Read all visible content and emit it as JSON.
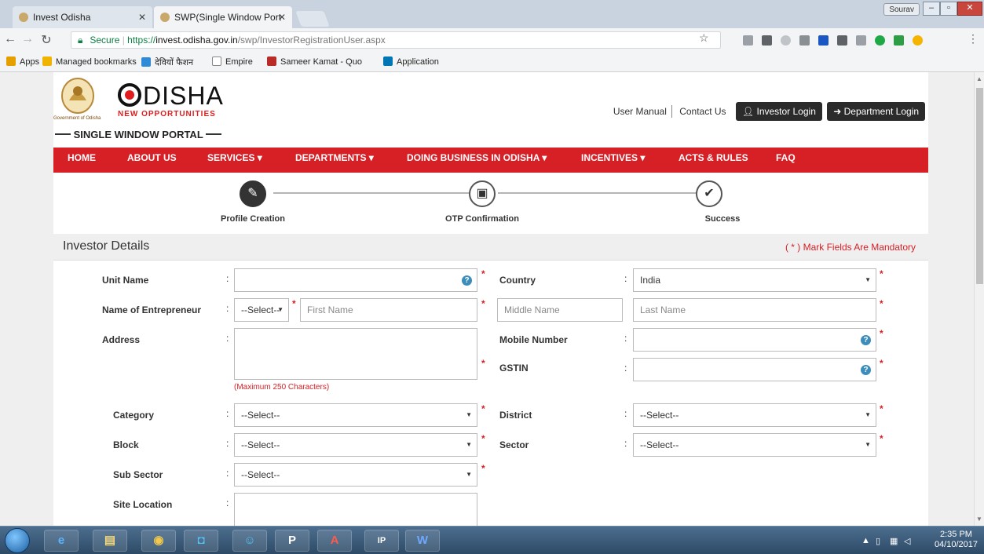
{
  "browser": {
    "tabs": [
      {
        "title": "Invest Odisha",
        "active": false
      },
      {
        "title": "SWP(Single Window Port",
        "active": true
      }
    ],
    "profile": "Sourav",
    "url": {
      "secure_label": "Secure",
      "scheme": "https://",
      "host": "invest.odisha.gov.in",
      "path": "/swp/InvestorRegistrationUser.aspx"
    },
    "bookmarks": [
      {
        "label": "Apps",
        "icon": "apps-grid-icon",
        "color": "#e5a000"
      },
      {
        "label": "Managed bookmarks",
        "icon": "folder-icon",
        "color": "#f0b400"
      },
      {
        "label": "देवियों फैशन",
        "icon": "folder-icon",
        "color": "#2f8ad8"
      },
      {
        "label": "Empire",
        "icon": "page-icon",
        "color": "#888888"
      },
      {
        "label": "Sameer Kamat - Quo",
        "icon": "quora-icon",
        "color": "#b92b27"
      },
      {
        "label": "Application",
        "icon": "linkedin-icon",
        "color": "#0077b5"
      }
    ]
  },
  "site": {
    "emblem_caption": "Government of Odisha",
    "brand": "DISHA",
    "brand_sub": "NEW OPPORTUNITIES",
    "portal": "SINGLE WINDOW PORTAL",
    "top_links": {
      "manual": "User Manual",
      "contact": "Contact Us",
      "investor_login": "Investor Login",
      "department_login": "Department Login"
    },
    "nav": [
      "HOME",
      "ABOUT US",
      "SERVICES ▾",
      "DEPARTMENTS ▾",
      "DOING BUSINESS IN ODISHA ▾",
      "INCENTIVES ▾",
      "ACTS & RULES",
      "FAQ"
    ]
  },
  "steps": [
    {
      "label": "Profile Creation",
      "icon": "pencil-icon",
      "done": true
    },
    {
      "label": "OTP Confirmation",
      "icon": "image-icon",
      "done": false
    },
    {
      "label": "Success",
      "icon": "check-icon",
      "done": false
    }
  ],
  "section": {
    "title": "Investor Details",
    "mandatory_note": "( * ) Mark Fields Are Mandatory"
  },
  "form": {
    "unit_name": {
      "label": "Unit Name",
      "value": ""
    },
    "country": {
      "label": "Country",
      "value": "India"
    },
    "entrepreneur": {
      "label": "Name of Entrepreneur",
      "salutation": "--Select--",
      "first_placeholder": "First Name",
      "middle_placeholder": "Middle Name",
      "last_placeholder": "Last Name"
    },
    "address": {
      "label": "Address",
      "value": "",
      "hint": "(Maximum 250 Characters)"
    },
    "mobile": {
      "label": "Mobile Number",
      "value": ""
    },
    "gstin": {
      "label": "GSTIN",
      "value": ""
    },
    "category": {
      "label": "Category",
      "value": "--Select--"
    },
    "district": {
      "label": "District",
      "value": "--Select--"
    },
    "block": {
      "label": "Block",
      "value": "--Select--"
    },
    "sector": {
      "label": "Sector",
      "value": "--Select--"
    },
    "sub_sector": {
      "label": "Sub Sector",
      "value": "--Select--"
    },
    "site_location": {
      "label": "Site Location",
      "value": ""
    }
  },
  "taskbar": {
    "apps": [
      {
        "name": "ie",
        "glyph": "e"
      },
      {
        "name": "explorer",
        "glyph": "▤"
      },
      {
        "name": "chrome",
        "glyph": "◉"
      },
      {
        "name": "app-o",
        "glyph": "◘"
      },
      {
        "name": "people",
        "glyph": "☺"
      },
      {
        "name": "p-app",
        "glyph": "P"
      },
      {
        "name": "acrobat",
        "glyph": "A"
      },
      {
        "name": "ip",
        "glyph": "IP"
      },
      {
        "name": "word",
        "glyph": "W"
      }
    ],
    "time": "2:35 PM",
    "date": "04/10/2017"
  }
}
